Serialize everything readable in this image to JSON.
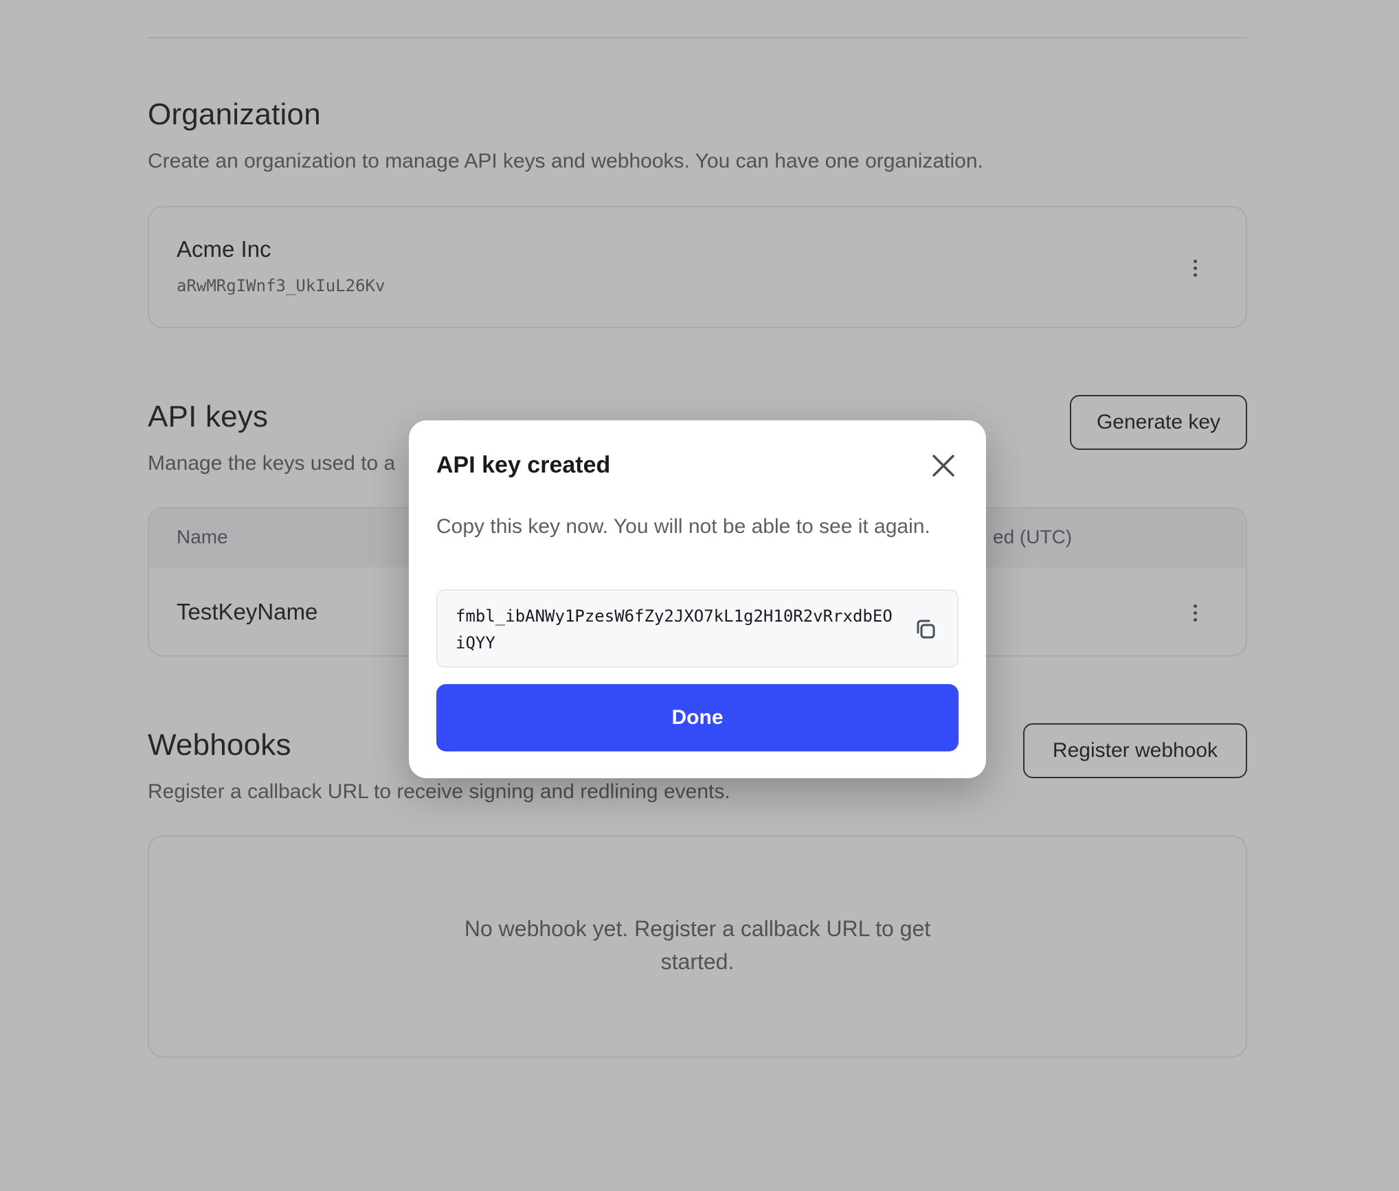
{
  "organization": {
    "title": "Organization",
    "description": "Create an organization to manage API keys and webhooks. You can have one organization.",
    "name": "Acme Inc",
    "id": "aRwMRgIWnf3_UkIuL26Kv"
  },
  "api_keys": {
    "title": "API keys",
    "description_visible": "Manage the keys used to a",
    "generate_button": "Generate key",
    "columns": {
      "name": "Name",
      "created_partial": "ed (UTC)"
    },
    "rows": [
      {
        "name": "TestKeyName"
      }
    ]
  },
  "webhooks": {
    "title": "Webhooks",
    "description": "Register a callback URL to receive signing and redlining events.",
    "register_button": "Register webhook",
    "empty_line1": "No webhook yet. Register a callback URL to get",
    "empty_line2": "started."
  },
  "modal": {
    "title": "API key created",
    "description": "Copy this key now. You will not be able to see it again.",
    "key": "fmbl_ibANWy1PzesW6fZy2JXO7kL1g2H10R2vRrxdbEOiQYY",
    "done_button": "Done",
    "icons": {
      "close": "close-icon",
      "copy": "copy-icon"
    }
  },
  "colors": {
    "accent": "#344cf8",
    "overlay": "rgba(60,60,60,0.36)",
    "muted_text": "#5b5f68"
  }
}
